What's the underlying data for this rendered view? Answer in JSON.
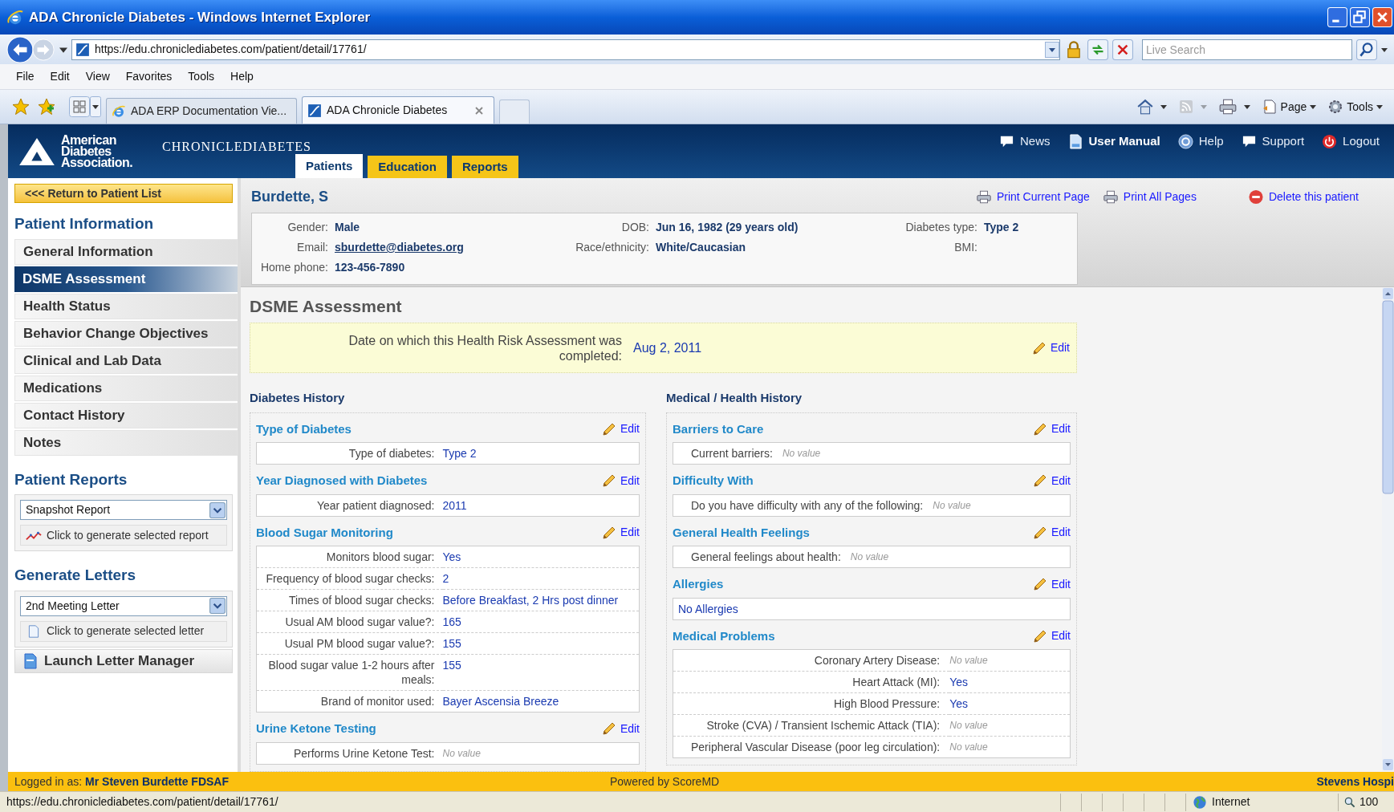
{
  "browser": {
    "title": "ADA Chronicle Diabetes - Windows Internet Explorer",
    "address": "https://edu.chroniclediabetes.com/patient/detail/17761/",
    "search": {
      "placeholder": "Live Search"
    },
    "menu": [
      "File",
      "Edit",
      "View",
      "Favorites",
      "Tools",
      "Help"
    ],
    "tabs": [
      {
        "label": "ADA ERP Documentation Vie...",
        "selected": false
      },
      {
        "label": "ADA Chronicle Diabetes",
        "selected": true
      }
    ],
    "toolbar": [
      {
        "label": "Page",
        "kind": "page"
      },
      {
        "label": "Tools",
        "kind": "tools"
      }
    ]
  },
  "app": {
    "logo": {
      "org": [
        "American",
        "Diabetes",
        "Association."
      ],
      "product": [
        "CHRONICLE",
        "DIABETES"
      ]
    },
    "nav_tabs": [
      {
        "label": "Patients",
        "selected": true
      },
      {
        "label": "Education",
        "selected": false
      },
      {
        "label": "Reports",
        "selected": false
      }
    ],
    "top_links": [
      {
        "label": "News",
        "kind": "news",
        "highlighted": false
      },
      {
        "label": "User Manual",
        "kind": "manual",
        "highlighted": true
      },
      {
        "label": "Help",
        "kind": "help",
        "highlighted": false
      },
      {
        "label": "Support",
        "kind": "support",
        "highlighted": false
      },
      {
        "label": "Logout",
        "kind": "logout",
        "highlighted": false
      }
    ]
  },
  "sidebar": {
    "return_button": "<<< Return to Patient List",
    "patient_info": {
      "heading": "Patient Information",
      "items": [
        {
          "label": "General Information",
          "selected": false
        },
        {
          "label": "DSME Assessment",
          "selected": true
        },
        {
          "label": "Health Status",
          "selected": false
        },
        {
          "label": "Behavior Change Objectives",
          "selected": false
        },
        {
          "label": "Clinical and Lab Data",
          "selected": false
        },
        {
          "label": "Medications",
          "selected": false
        },
        {
          "label": "Contact History",
          "selected": false
        },
        {
          "label": "Notes",
          "selected": false
        }
      ]
    },
    "reports": {
      "heading": "Patient Reports",
      "select": "Snapshot Report",
      "button": "Click to generate selected report"
    },
    "letters": {
      "heading": "Generate Letters",
      "select": "2nd Meeting Letter",
      "button": "Click to generate selected letter",
      "manager_button": "Launch Letter Manager"
    }
  },
  "patient": {
    "name": "Burdette, S",
    "actions": [
      {
        "label": "Print Current Page",
        "kind": "print"
      },
      {
        "label": "Print All Pages",
        "kind": "print"
      },
      {
        "label": "Delete this patient",
        "kind": "delete"
      }
    ],
    "info": [
      {
        "label": "Gender:",
        "value": "Male"
      },
      {
        "label": "DOB:",
        "value": "Jun 16, 1982 (29 years old)"
      },
      {
        "label": "Diabetes type:",
        "value": "Type 2"
      },
      {
        "label": "Email:",
        "value": "sburdette@diabetes.org",
        "kind": "link"
      },
      {
        "label": "Race/ethnicity:",
        "value": "White/Caucasian"
      },
      {
        "label": "BMI:"
      },
      {
        "label": "Home phone:",
        "value": "123-456-7890"
      }
    ]
  },
  "assessment": {
    "title": "DSME Assessment",
    "completed": {
      "label": "Date on which this Health Risk Assessment was completed:",
      "value": "Aug 2, 2011",
      "edit": "Edit"
    },
    "columns": [
      {
        "heading": "Diabetes History",
        "sections": [
          {
            "title": "Type of Diabetes",
            "edit": "Edit",
            "rows": [
              {
                "label": "Type of diabetes:",
                "value": "Type 2",
                "missing": false
              }
            ]
          },
          {
            "title": "Year Diagnosed with Diabetes",
            "edit": "Edit",
            "rows": [
              {
                "label": "Year patient diagnosed:",
                "value": "2011",
                "missing": false
              }
            ]
          },
          {
            "title": "Blood Sugar Monitoring",
            "edit": "Edit",
            "rows": [
              {
                "label": "Monitors blood sugar:",
                "value": "Yes",
                "missing": false
              },
              {
                "label": "Frequency of blood sugar checks:",
                "value": "2",
                "missing": false
              },
              {
                "label": "Times of blood sugar checks:",
                "value": "Before Breakfast, 2 Hrs post dinner",
                "missing": false
              },
              {
                "label": "Usual AM blood sugar value?:",
                "value": "165",
                "missing": false
              },
              {
                "label": "Usual PM blood sugar value?:",
                "value": "155",
                "missing": false
              },
              {
                "label": "Blood sugar value 1-2 hours after meals:",
                "value": "155",
                "missing": false
              },
              {
                "label": "Brand of monitor used:",
                "value": "Bayer Ascensia Breeze",
                "missing": false
              }
            ]
          },
          {
            "title": "Urine Ketone Testing",
            "edit": "Edit",
            "rows": [
              {
                "label": "Performs Urine Ketone Test:",
                "value": "No value",
                "missing": true
              }
            ]
          }
        ]
      },
      {
        "heading": "Medical / Health History",
        "sections": [
          {
            "title": "Barriers to Care",
            "edit": "Edit",
            "rows": [
              {
                "label": "Current barriers:",
                "value": "No value",
                "missing": true
              }
            ]
          },
          {
            "title": "Difficulty With",
            "edit": "Edit",
            "rows": [
              {
                "label": "Do you have difficulty with any of the following:",
                "value": "No value",
                "missing": true
              }
            ]
          },
          {
            "title": "General Health Feelings",
            "edit": "Edit",
            "rows": [
              {
                "label": "General feelings about health:",
                "value": "No value",
                "missing": true
              }
            ]
          },
          {
            "title": "Allergies",
            "edit": "Edit",
            "rows": [
              {
                "value": "No Allergies",
                "missing": false
              }
            ]
          },
          {
            "title": "Medical Problems",
            "edit": "Edit",
            "rows": [
              {
                "label": "Coronary Artery Disease:",
                "value": "No value",
                "missing": true
              },
              {
                "label": "Heart Attack (MI):",
                "value": "Yes",
                "missing": false
              },
              {
                "label": "High Blood Pressure:",
                "value": "Yes",
                "missing": false
              },
              {
                "label": "Stroke (CVA) / Transient Ischemic Attack (TIA):",
                "value": "No value",
                "missing": true
              },
              {
                "label": "Peripheral Vascular Disease (poor leg circulation):",
                "value": "No value",
                "missing": true
              }
            ]
          }
        ]
      }
    ]
  },
  "footer": {
    "logged_in_label": "Logged in as:",
    "user": "Mr Steven Burdette FDSAF",
    "powered": "Powered by ScoreMD",
    "organization": "Stevens Hospi"
  },
  "status_bar": {
    "url": "https://edu.chroniclediabetes.com/patient/detail/17761/",
    "zone": "Internet",
    "zoom": "100"
  }
}
